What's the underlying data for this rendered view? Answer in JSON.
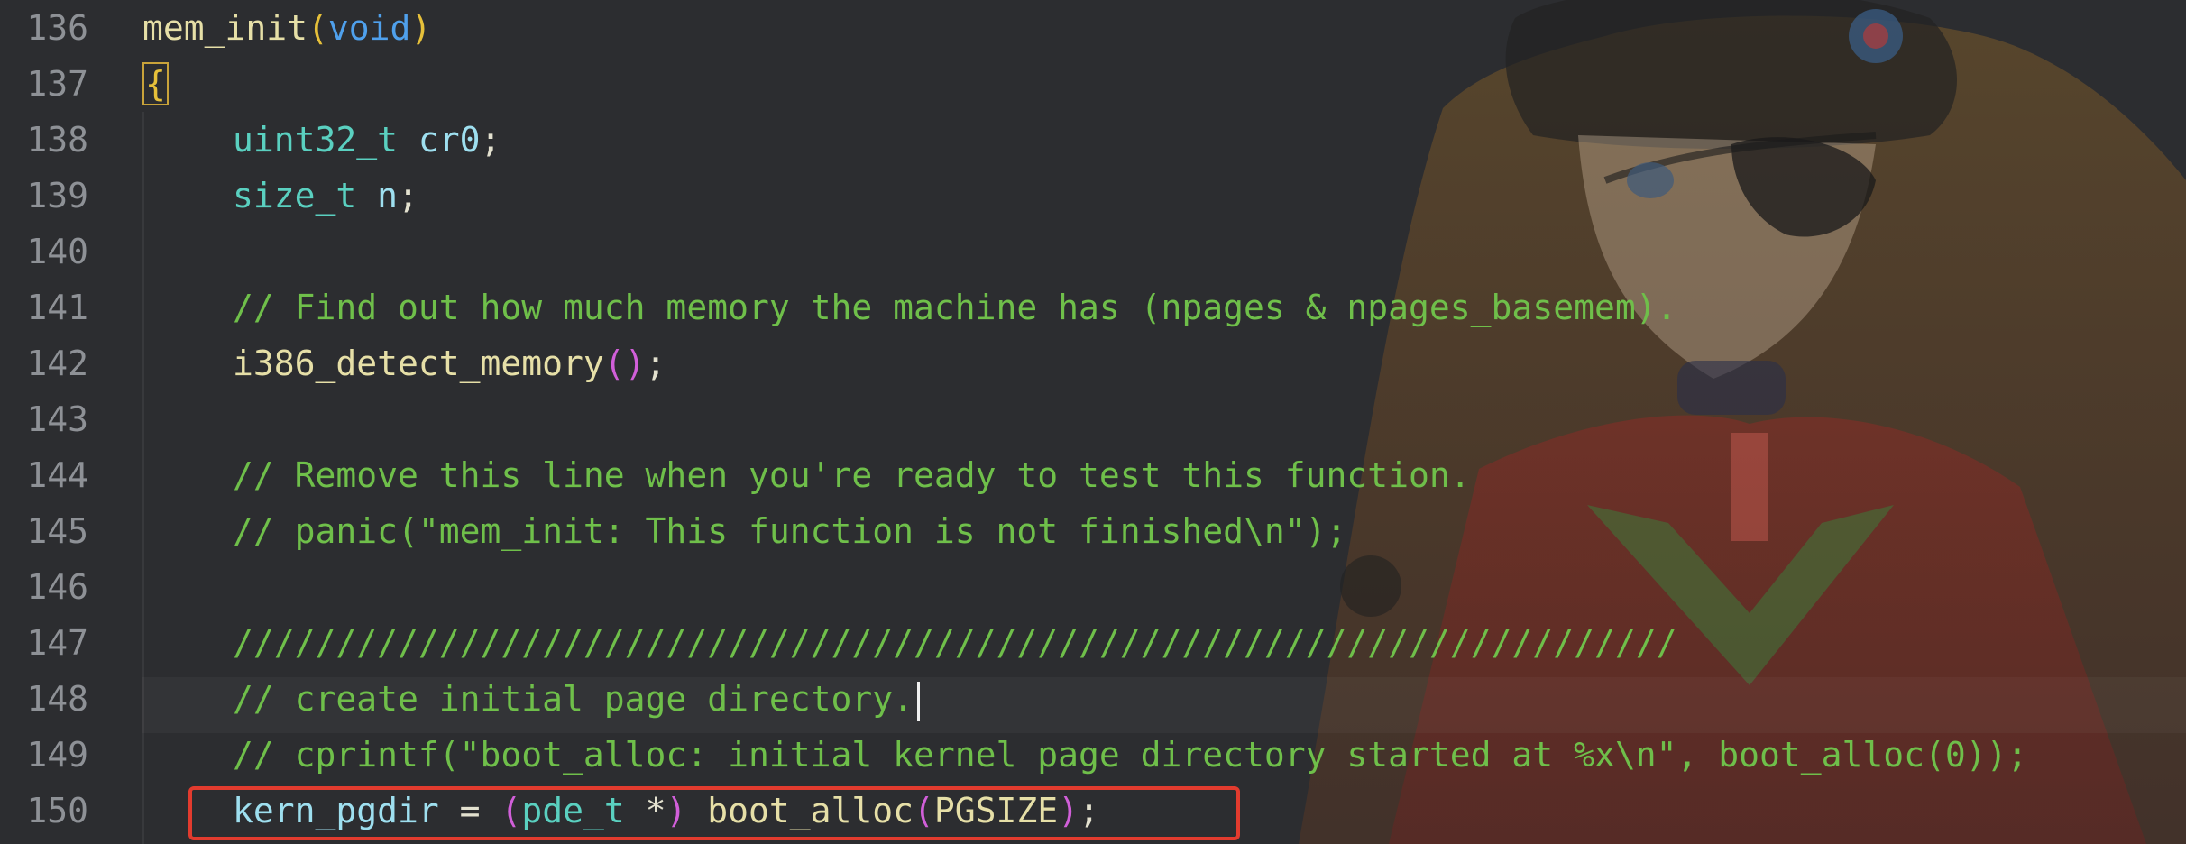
{
  "editor": {
    "line_numbers": [
      "136",
      "137",
      "138",
      "139",
      "140",
      "141",
      "142",
      "143",
      "144",
      "145",
      "146",
      "147",
      "148",
      "149",
      "150"
    ]
  },
  "code": {
    "l136": {
      "fn": "mem_init",
      "open": "(",
      "kw": "void",
      "close": ")"
    },
    "l137": {
      "brace": "{"
    },
    "l138": {
      "type": "uint32_t",
      "var": "cr0",
      "semi": ";"
    },
    "l139": {
      "type": "size_t",
      "var": "n",
      "semi": ";"
    },
    "l141": {
      "comment": "// Find out how much memory the machine has (npages & npages_basemem)."
    },
    "l142": {
      "fn": "i386_detect_memory",
      "open": "(",
      "close": ")",
      "semi": ";"
    },
    "l144": {
      "comment": "// Remove this line when you're ready to test this function."
    },
    "l145": {
      "comment": "// panic(\"mem_init: This function is not finished\\n\");"
    },
    "l147": {
      "comment": "//////////////////////////////////////////////////////////////////////"
    },
    "l148": {
      "comment": "// create initial page directory."
    },
    "l149": {
      "comment": "// cprintf(\"boot_alloc: initial kernel page directory started at %x\\n\", boot_alloc(0));"
    },
    "l150": {
      "var": "kern_pgdir",
      "eq": " = ",
      "open1": "(",
      "type": "pde_t",
      "star": " *",
      "close1": ")",
      "fn": "boot_alloc",
      "open2": "(",
      "macro": "PGSIZE",
      "close2": ")",
      "semi": ";"
    }
  },
  "colors": {
    "background": "#2c2d30",
    "comment": "#6fbf4a",
    "type": "#5ad0c0",
    "keyword": "#4fa0ec",
    "function": "#e6dfa7",
    "highlight_box": "#e23b2e"
  },
  "decorations": {
    "background_art": "anime-character-wallpaper"
  }
}
